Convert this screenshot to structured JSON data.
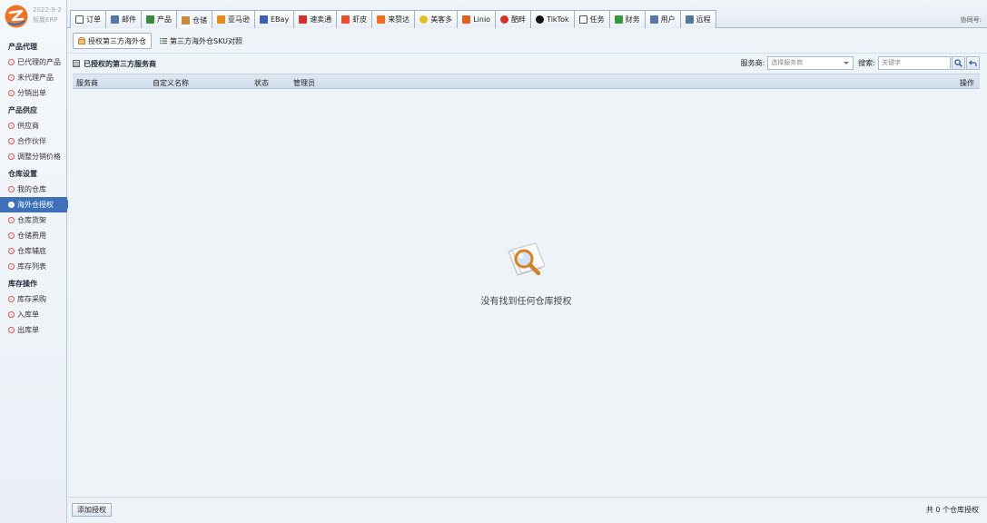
{
  "app": {
    "date": "2022-9-2",
    "name": "智赢ERP"
  },
  "topbar": {
    "tabs": [
      {
        "label": "订单",
        "icon": "order-icon",
        "color": "#444444"
      },
      {
        "label": "邮件",
        "icon": "mail-icon",
        "color": "#5577aa"
      },
      {
        "label": "产品",
        "icon": "product-icon",
        "color": "#3a8a3a"
      },
      {
        "label": "仓储",
        "icon": "warehouse-icon",
        "color": "#c98a3a",
        "active": true
      },
      {
        "label": "亚马逊",
        "icon": "amazon-icon",
        "color": "#e88a1a"
      },
      {
        "label": "EBay",
        "icon": "ebay-icon",
        "color": "#3a5fb0"
      },
      {
        "label": "速卖通",
        "icon": "aliexpress-icon",
        "color": "#d9302c"
      },
      {
        "label": "虾皮",
        "icon": "shopee-icon",
        "color": "#ee4d2d"
      },
      {
        "label": "来赞达",
        "icon": "lazada-icon",
        "color": "#f36b21"
      },
      {
        "label": "美客多",
        "icon": "mercadolibre-icon",
        "color": "#e0c020"
      },
      {
        "label": "Linio",
        "icon": "linio-icon",
        "color": "#e06020"
      },
      {
        "label": "酷畔",
        "icon": "coupang-icon",
        "color": "#d9302c"
      },
      {
        "label": "TikTok",
        "icon": "tiktok-icon",
        "color": "#111111"
      },
      {
        "label": "任务",
        "icon": "task-icon",
        "color": "#444444"
      },
      {
        "label": "财务",
        "icon": "finance-icon",
        "color": "#3a9a3a"
      },
      {
        "label": "用户",
        "icon": "user-icon",
        "color": "#5577aa"
      },
      {
        "label": "远程",
        "icon": "remote-icon",
        "color": "#557799"
      }
    ],
    "collab_label": "协同号:"
  },
  "sidebar": {
    "sections": [
      {
        "title": "产品代理",
        "items": [
          {
            "label": "已代理的产品"
          },
          {
            "label": "未代理产品"
          },
          {
            "label": "分销出单"
          }
        ]
      },
      {
        "title": "产品供应",
        "items": [
          {
            "label": "供应商"
          },
          {
            "label": "合作伙伴"
          },
          {
            "label": "调整分销价格"
          }
        ]
      },
      {
        "title": "仓库设置",
        "items": [
          {
            "label": "我的仓库"
          },
          {
            "label": "海外仓授权",
            "active": true
          },
          {
            "label": "仓库货架"
          },
          {
            "label": "仓储费用"
          },
          {
            "label": "仓库辅底"
          },
          {
            "label": "库存列表"
          }
        ]
      },
      {
        "title": "库存操作",
        "items": [
          {
            "label": "库存采购"
          },
          {
            "label": "入库单"
          },
          {
            "label": "出库单"
          }
        ]
      }
    ]
  },
  "main": {
    "subtabs": [
      {
        "label": "授权第三方海外仓",
        "icon": "authorize-icon",
        "active": true
      },
      {
        "label": "第三方海外仓SKU对照",
        "icon": "list-icon"
      }
    ],
    "panel_title": "已授权的第三方服务商",
    "filter": {
      "provider_label": "服务商:",
      "provider_placeholder": "选择服务商",
      "search_label": "搜索:",
      "search_placeholder": "关键字"
    },
    "table": {
      "columns": [
        "服务商",
        "自定义名称",
        "状态",
        "管理员",
        "操作"
      ],
      "rows": []
    },
    "empty_message": "没有找到任何仓库授权",
    "add_button": "添加授权",
    "total_text": "共 0 个仓库授权"
  },
  "colors": {
    "accent": "#3f71b8",
    "sidebar_dot": "#d05050",
    "background": "#eef3f8"
  }
}
